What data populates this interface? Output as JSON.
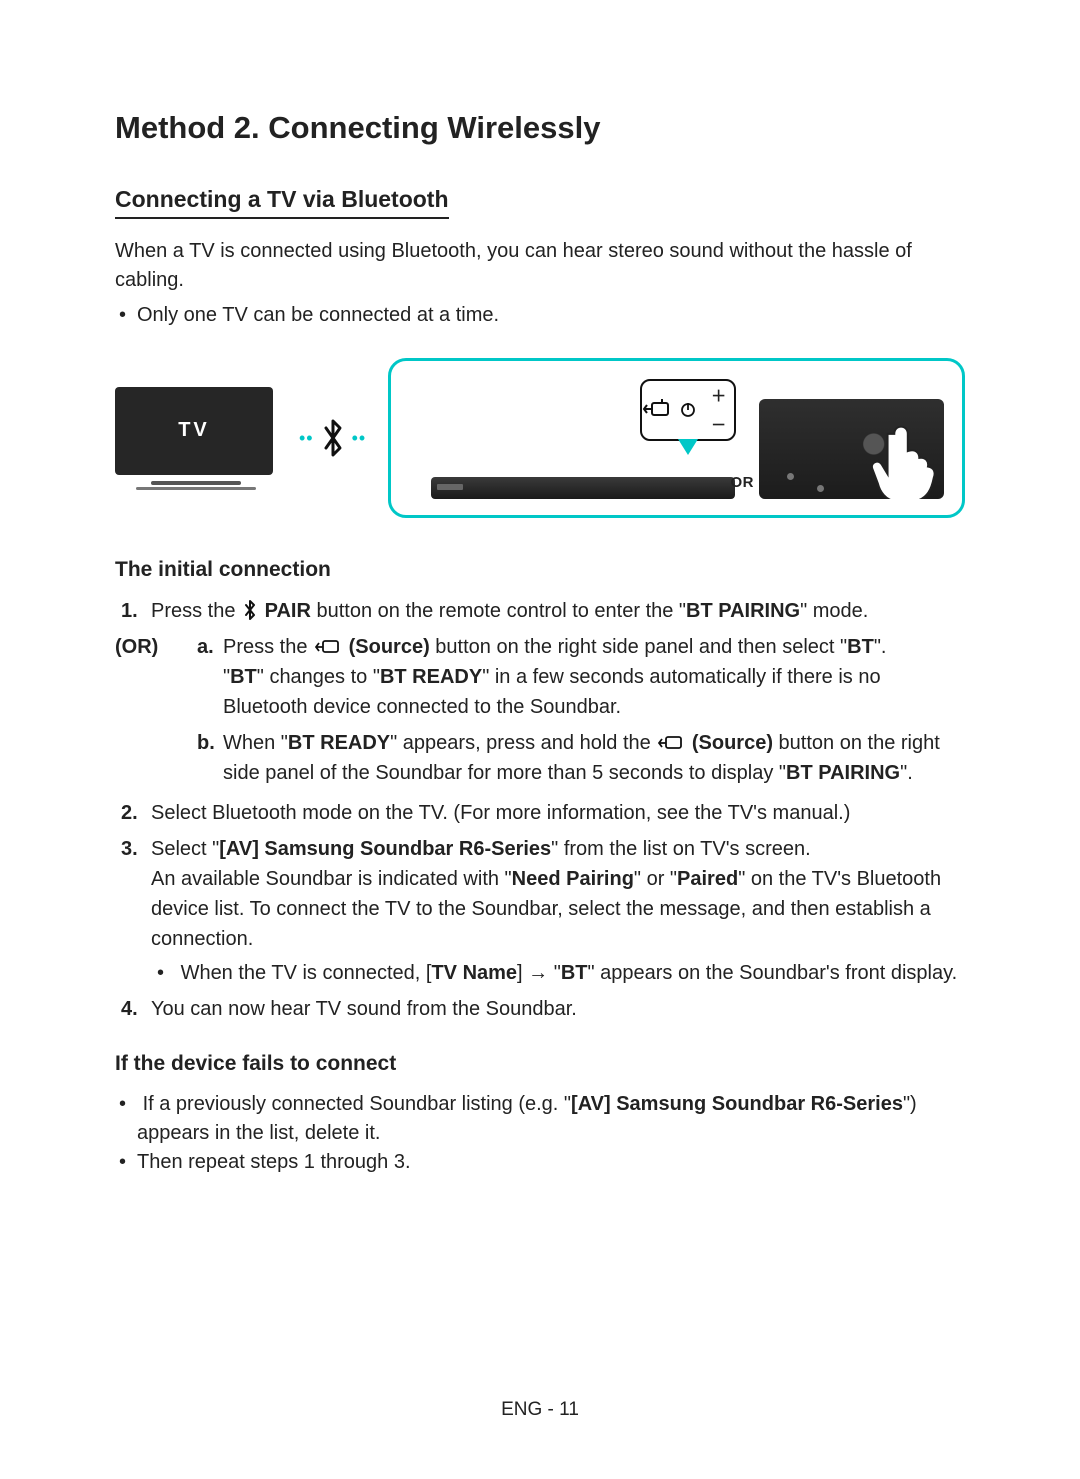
{
  "headings": {
    "h1": "Method 2. Connecting Wirelessly",
    "h2": "Connecting a TV via Bluetooth",
    "h3_initial": "The initial connection",
    "h3_fail": "If the device fails to connect"
  },
  "intro": "When a TV is connected using Bluetooth, you can hear stereo sound without the hassle of cabling.",
  "intro_bullet": "Only one TV can be connected at a time.",
  "diagram": {
    "tv_label": "TV",
    "or_label": "OR"
  },
  "steps": {
    "s1_pre": "Press the ",
    "s1_pair": "PAIR",
    "s1_mid": " button on the remote control to enter the \"",
    "s1_btpairing": "BT PAIRING",
    "s1_post": "\" mode.",
    "or_word": "(OR)",
    "a_pre": "Press the ",
    "a_source": "(Source)",
    "a_mid": " button on the right side panel and then select \"",
    "a_bt": "BT",
    "a_post": "\".",
    "a2_pre": "\"",
    "a2_bt": "BT",
    "a2_mid": "\" changes to \"",
    "a2_btready": "BT READY",
    "a2_post": "\" in a few seconds automatically if there is no Bluetooth device connected to the Soundbar.",
    "b_pre": "When \"",
    "b_btready": "BT READY",
    "b_mid1": "\" appears, press and hold the ",
    "b_source": "(Source)",
    "b_mid2": " button on the right side panel of the Soundbar for more than 5 seconds to display \"",
    "b_btpairing": "BT PAIRING",
    "b_post": "\".",
    "s2": "Select Bluetooth mode on the TV. (For more information, see the TV's manual.)",
    "s3_pre": "Select \"",
    "s3_model": "[AV] Samsung Soundbar R6-Series",
    "s3_post": "\" from the list on TV's screen.",
    "s3b_pre": "An available Soundbar is indicated with \"",
    "s3b_need": "Need Pairing",
    "s3b_or": "\" or \"",
    "s3b_paired": "Paired",
    "s3b_post": "\" on the TV's Bluetooth device list. To connect the TV to the Soundbar, select the message, and then establish a connection.",
    "s3c_pre": "When the TV is connected, [",
    "s3c_tvname": "TV Name",
    "s3c_mid": "] → \"",
    "s3c_bt": "BT",
    "s3c_post": "\" appears on the Soundbar's front display.",
    "s4": "You can now hear TV sound from the Soundbar."
  },
  "fail": {
    "f1_pre": "If a previously connected Soundbar listing (e.g. \"",
    "f1_model": "[AV] Samsung Soundbar R6-Series",
    "f1_post": "\") appears in the list, delete it.",
    "f2": "Then repeat steps 1 through 3."
  },
  "footer": "ENG - 11"
}
